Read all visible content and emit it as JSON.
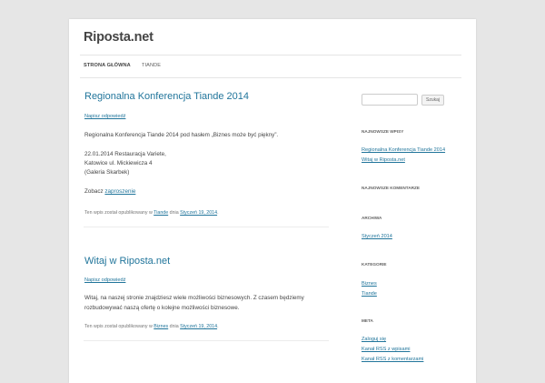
{
  "site": {
    "title": "Riposta.net"
  },
  "nav": {
    "items": [
      "Strona główna",
      "Tiande"
    ]
  },
  "posts": [
    {
      "title": "Regionalna Konferencja Tiande 2014",
      "reply": "Napisz odpowiedź",
      "paragraphs": [
        "Regionalna Konferencja Tiande 2014 pod hasłem „Biznes może być piękny”.",
        "22.01.2014 Restauracja Variete,",
        "Katowice ul. Mickiewicza 4",
        "(Galeria Skarbek)"
      ],
      "invite_prefix": "Zobacz ",
      "invite_link": "zaproszenie",
      "meta_prefix": "Ten wpis został opublikowany w ",
      "category": "Tiande",
      "meta_date_prefix": " dnia ",
      "date": "Styczeń 19, 2014",
      "meta_suffix": "."
    },
    {
      "title": "Witaj w Riposta.net",
      "reply": "Napisz odpowiedź",
      "paragraphs": [
        "Witaj, na naszej stronie znajdziesz wiele możliwości biznesowych. Z czasem będziemy",
        "rozbudowywać naszą ofertę o kolejne możliwości biznesowe."
      ],
      "meta_prefix": "Ten wpis został opublikowany w ",
      "category": "Biznes",
      "meta_date_prefix": " dnia ",
      "date": "Styczeń 19, 2014",
      "meta_suffix": "."
    }
  ],
  "sidebar": {
    "search": {
      "button_label": "Szukaj",
      "value": ""
    },
    "widgets": [
      {
        "title": "Najnowsze wpisy",
        "links": [
          "Regionalna Konferencja Tiande 2014",
          "Witaj w Riposta.net"
        ]
      },
      {
        "title": "Najnowsze komentarze",
        "links": []
      },
      {
        "title": "Archiwa",
        "links": [
          "Styczeń 2014"
        ]
      },
      {
        "title": "Kategorie",
        "links": [
          "Biznes",
          "Tiande"
        ]
      },
      {
        "title": "Meta",
        "links": [
          "Zaloguj się",
          "Kanał RSS z wpisami",
          "Kanał RSS z komentarzami"
        ]
      }
    ]
  },
  "colors": {
    "link": "#21759b",
    "background": "#e6e6e6",
    "text": "#444444"
  }
}
